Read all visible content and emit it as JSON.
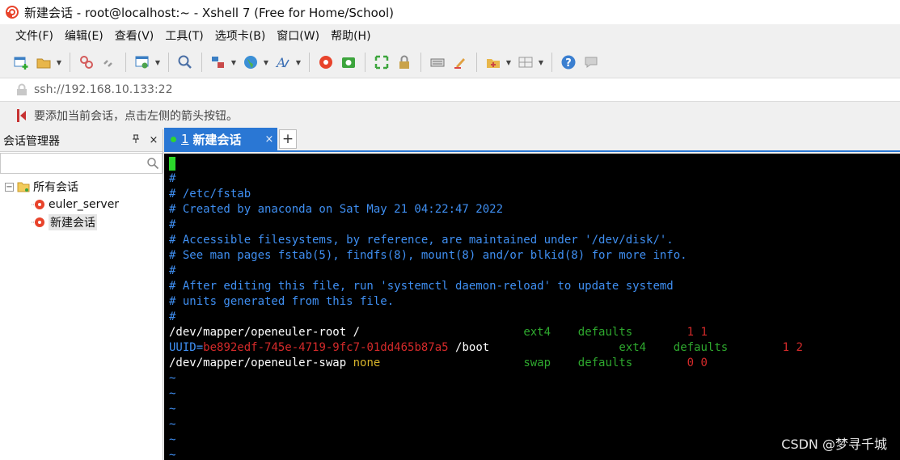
{
  "window": {
    "title": "新建会话 - root@localhost:~ - Xshell 7 (Free for Home/School)"
  },
  "menu": [
    "文件(F)",
    "编辑(E)",
    "查看(V)",
    "工具(T)",
    "选项卡(B)",
    "窗口(W)",
    "帮助(H)"
  ],
  "toolbar": {
    "icons": [
      "new-session-icon",
      "open-folder-icon",
      "disconnect-icon",
      "reconnect-icon",
      "properties-icon",
      "find-icon",
      "transfer-icon",
      "globe-icon",
      "font-icon",
      "xshell-icon",
      "xftp-icon",
      "fullscreen-icon",
      "lock-icon",
      "keyboard-icon",
      "highlight-icon",
      "new-tab-icon",
      "layout-icon",
      "help-icon",
      "chat-icon"
    ]
  },
  "address": {
    "value": "ssh://192.168.10.133:22"
  },
  "hint": {
    "text": "要添加当前会话，点击左侧的箭头按钮。"
  },
  "sidebar": {
    "title": "会话管理器",
    "pin_label": "ᵽ",
    "close_label": "×",
    "search_placeholder": "",
    "root_label": "所有会话",
    "root_expander": "−",
    "items": [
      {
        "label": "euler_server"
      },
      {
        "label": "新建会话"
      }
    ]
  },
  "tabs": {
    "active": {
      "number": "1",
      "label": "新建会话",
      "close": "×"
    },
    "add_label": "+"
  },
  "terminal": {
    "lines": [
      "#",
      "# /etc/fstab",
      "# Created by anaconda on Sat May 21 04:22:47 2022",
      "#",
      "# Accessible filesystems, by reference, are maintained under '/dev/disk/'.",
      "# See man pages fstab(5), findfs(8), mount(8) and/or blkid(8) for more info.",
      "#",
      "# After editing this file, run 'systemctl daemon-reload' to update systemd",
      "# units generated from this file.",
      "#"
    ],
    "fstab": [
      {
        "device": "/dev/mapper/openeuler-root",
        "mount": "/",
        "fs": "ext4",
        "options": "defaults",
        "dump": "1 1"
      },
      {
        "uuid_prefix": "UUID=",
        "uuid": "be892edf-745e-4719-9fc7-01dd465b87a5",
        "mount": "/boot",
        "fs": "ext4",
        "options": "defaults",
        "dump": "1 2"
      },
      {
        "device": "/dev/mapper/openeuler-swap",
        "mount": "none",
        "fs": "swap",
        "options": "defaults",
        "dump": "0 0"
      }
    ],
    "tilde": [
      "~",
      "~",
      "~",
      "~",
      "~",
      "~"
    ]
  },
  "watermark": "CSDN @梦寻千城",
  "colors": {
    "tab_active": "#2a77d4",
    "comment": "#3f8ff2",
    "green": "#2ea82e",
    "red": "#d42a2a",
    "yellow": "#d6b32a",
    "cursor": "#2bd82b"
  }
}
